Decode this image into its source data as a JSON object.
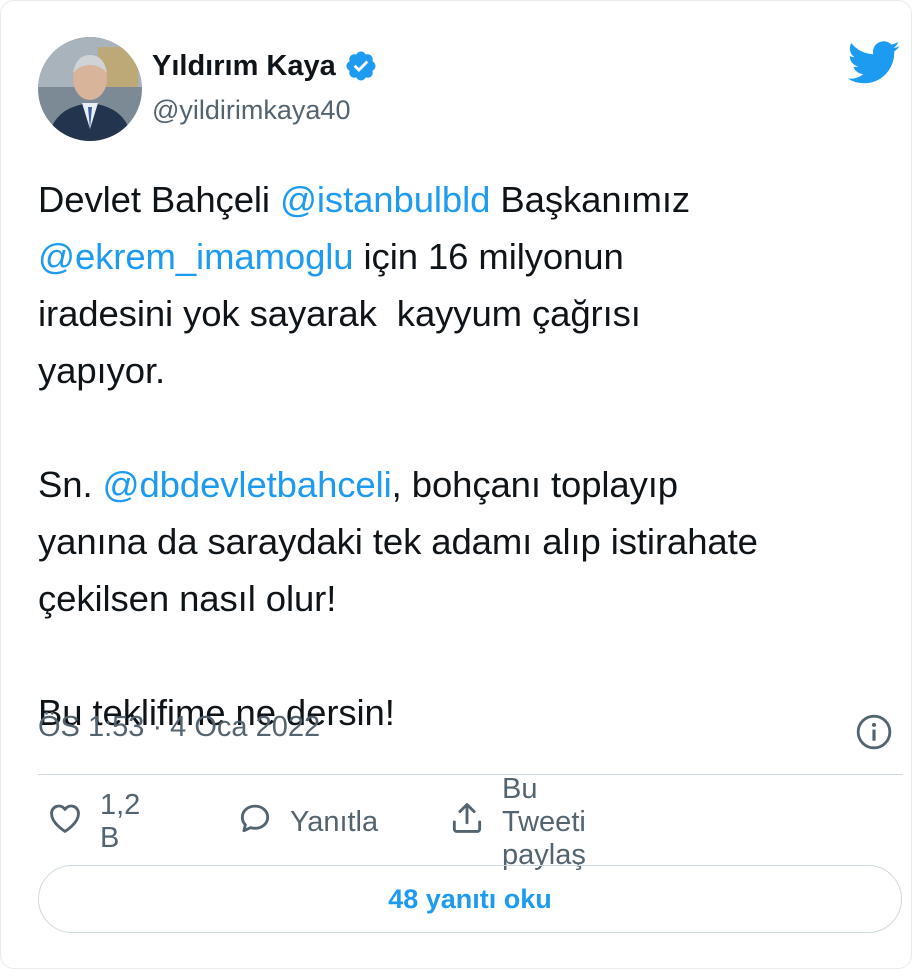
{
  "author": {
    "name": "Yıldırım Kaya",
    "handle": "@yildirimkaya40",
    "verified": true
  },
  "tweet": {
    "p1_l1_a": "Devlet Bahçeli ",
    "p1_l1_mention": "@istanbulbld",
    "p1_l1_b": " Başkanımız",
    "p1_l2_mention": "@ekrem_imamoglu",
    "p1_l2_b": " için 16 milyonun",
    "p1_l3": "iradesini yok sayarak  kayyum çağrısı",
    "p1_l4": "yapıyor.",
    "p2_l1_a": "Sn. ",
    "p2_l1_mention": "@dbdevletbahceli",
    "p2_l1_b": ", bohçanı toplayıp",
    "p2_l2": "yanına da saraydaki tek adamı alıp istirahate",
    "p2_l3": "çekilsen nasıl olur!",
    "p3_l1": "Bu teklifime ne dersin!"
  },
  "meta": {
    "timestamp": "ÖS 1:53 · 4 Oca 2022"
  },
  "actions": {
    "like_count": "1,2 B",
    "reply_label": "Yanıtla",
    "share_label": "Bu Tweeti paylaş"
  },
  "replies_button": "48 yanıtı oku",
  "colors": {
    "accent": "#1d9bf0",
    "secondary_text": "#536471",
    "border": "#cfd9de"
  },
  "icons": [
    "verified-badge-icon",
    "twitter-bird-icon",
    "info-icon",
    "heart-icon",
    "reply-bubble-icon",
    "share-icon"
  ]
}
